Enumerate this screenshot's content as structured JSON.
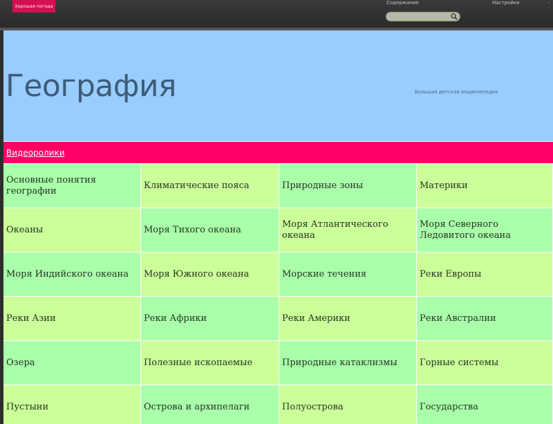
{
  "topbar": {
    "logo_text": "Хорошая погода",
    "contents_label": "Содержание",
    "settings_label": "Настройки",
    "caret": "-",
    "search_placeholder": ""
  },
  "header": {
    "title": "География",
    "subtitle": "Большая детская энциклопедия",
    "background": "#99ccff"
  },
  "videos": {
    "label": "Видеоролики",
    "background": "#ff0066"
  },
  "grid": {
    "colors": {
      "green": "#aaffaa",
      "lime": "#ccff99"
    },
    "cells": [
      "Основные понятия географии",
      "Климатические пояса",
      "Природные зоны",
      "Материки",
      "Океаны",
      "Моря Тихого океана",
      "Моря Атлантического океана",
      "Моря Северного Ледовитого океана",
      "Моря Индийского океана",
      "Моря Южного океана",
      "Морские течения",
      "Реки Европы",
      "Реки Азии",
      "Реки Африки",
      "Реки Америки",
      "Реки Австралии",
      "Озера",
      "Полезные ископаемые",
      "Природные катаклизмы",
      "Горные системы",
      "Пустыни",
      "Острова и архипелаги",
      "Полуострова",
      "Государства"
    ]
  }
}
